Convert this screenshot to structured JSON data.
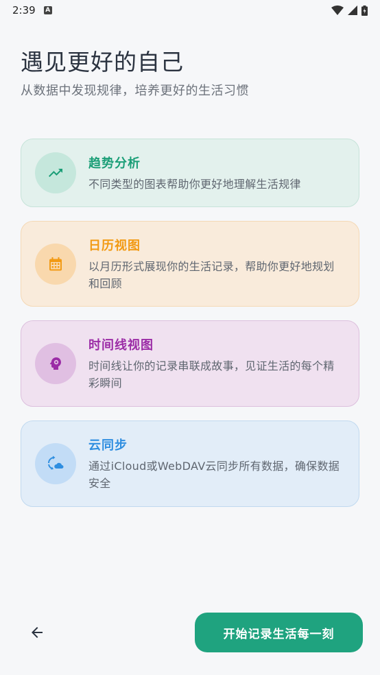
{
  "status_bar": {
    "time": "2:39",
    "notification_icon": "A"
  },
  "header": {
    "title": "遇见更好的自己",
    "subtitle": "从数据中发现规律，培养更好的生活习惯"
  },
  "features": [
    {
      "title": "趋势分析",
      "description": "不同类型的图表帮助你更好地理解生活规律",
      "icon": "trending-up-icon",
      "color": "#1b9e77"
    },
    {
      "title": "日历视图",
      "description": "以月历形式展现你的生活记录，帮助你更好地规划和回顾",
      "icon": "calendar-icon",
      "color": "#f29a14"
    },
    {
      "title": "时间线视图",
      "description": "时间线让你的记录串联成故事，见证生活的每个精彩瞬间",
      "icon": "psychology-icon",
      "color": "#9b2ca6"
    },
    {
      "title": "云同步",
      "description": "通过iCloud或WebDAV云同步所有数据，确保数据安全",
      "icon": "cloud-sync-icon",
      "color": "#2f8ee0"
    }
  ],
  "footer": {
    "back_icon": "arrow-left-icon",
    "start_label": "开始记录生活每一刻"
  }
}
